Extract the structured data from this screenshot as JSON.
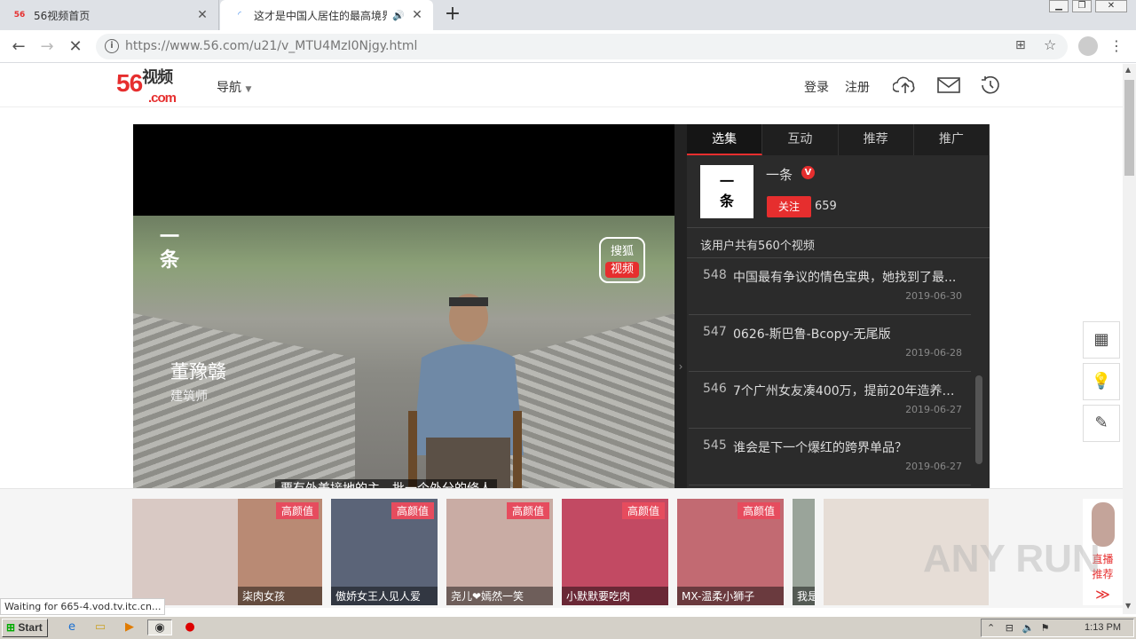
{
  "browser": {
    "tabs": [
      {
        "favicon": "56",
        "title": "56视频首页",
        "active": false
      },
      {
        "title": "这才是中国人居住的最高境界",
        "active": true
      }
    ],
    "url": "https://www.56.com/u21/v_MTU4MzI0Njgy.html",
    "status_text": "Waiting for 665-4.vod.tv.itc.cn..."
  },
  "header": {
    "logo_main": "56",
    "logo_cn": "视频",
    "logo_com": ".com",
    "nav_label": "导航",
    "login": "登录",
    "register": "注册"
  },
  "player": {
    "channel_mark": "一\n条",
    "sohu_line1": "搜狐",
    "sohu_line2": "视频",
    "person_name": "董豫赣",
    "person_role": "建筑师",
    "subtitle": "要有外美接地的主，批一个外分的修人"
  },
  "panel": {
    "tabs": [
      "选集",
      "互动",
      "推荐",
      "推广"
    ],
    "author": {
      "avatar_text": "一\n条",
      "name": "一条",
      "badge": "V",
      "follow_label": "关注",
      "followers": "659"
    },
    "video_count_text": "该用户共有560个视频",
    "videos": [
      {
        "num": "548",
        "title": "中国最有争议的情色宝典，她找到了最...",
        "date": "2019-06-30"
      },
      {
        "num": "547",
        "title": "0626-斯巴鲁-Bcopy-无尾版",
        "date": "2019-06-28"
      },
      {
        "num": "546",
        "title": "7个广州女友凑400万，提前20年造养老...",
        "date": "2019-06-27"
      },
      {
        "num": "545",
        "title": "谁会是下一个爆红的跨界单品？",
        "date": "2019-06-27"
      }
    ]
  },
  "float_tools": [
    "qrcode-icon",
    "lightbulb-icon",
    "edit-icon"
  ],
  "live": {
    "badge": "高颜值",
    "items": [
      {
        "name": "",
        "badge": false,
        "color": "#d9c9c4"
      },
      {
        "name": "柒肉女孩",
        "badge": true,
        "color": "#b98a74"
      },
      {
        "name": "傲娇女王人见人爱",
        "badge": true,
        "color": "#5b6478"
      },
      {
        "name": "尧儿❤嫣然一笑",
        "badge": true,
        "color": "#c9aca4"
      },
      {
        "name": "小默默要吃肉",
        "badge": true,
        "color": "#c24a63"
      },
      {
        "name": "MX-温柔小狮子",
        "badge": true,
        "color": "#c26a72"
      },
      {
        "name": "我是",
        "badge": false,
        "color": "#9aa49a"
      },
      {
        "name": "",
        "badge": false,
        "color": "#e6ddd6"
      }
    ],
    "side_label": "直播\n推荐",
    "side_more": "≫"
  },
  "watermark": "ANY RUN",
  "taskbar": {
    "start": "Start",
    "clock": "1:13 PM"
  }
}
